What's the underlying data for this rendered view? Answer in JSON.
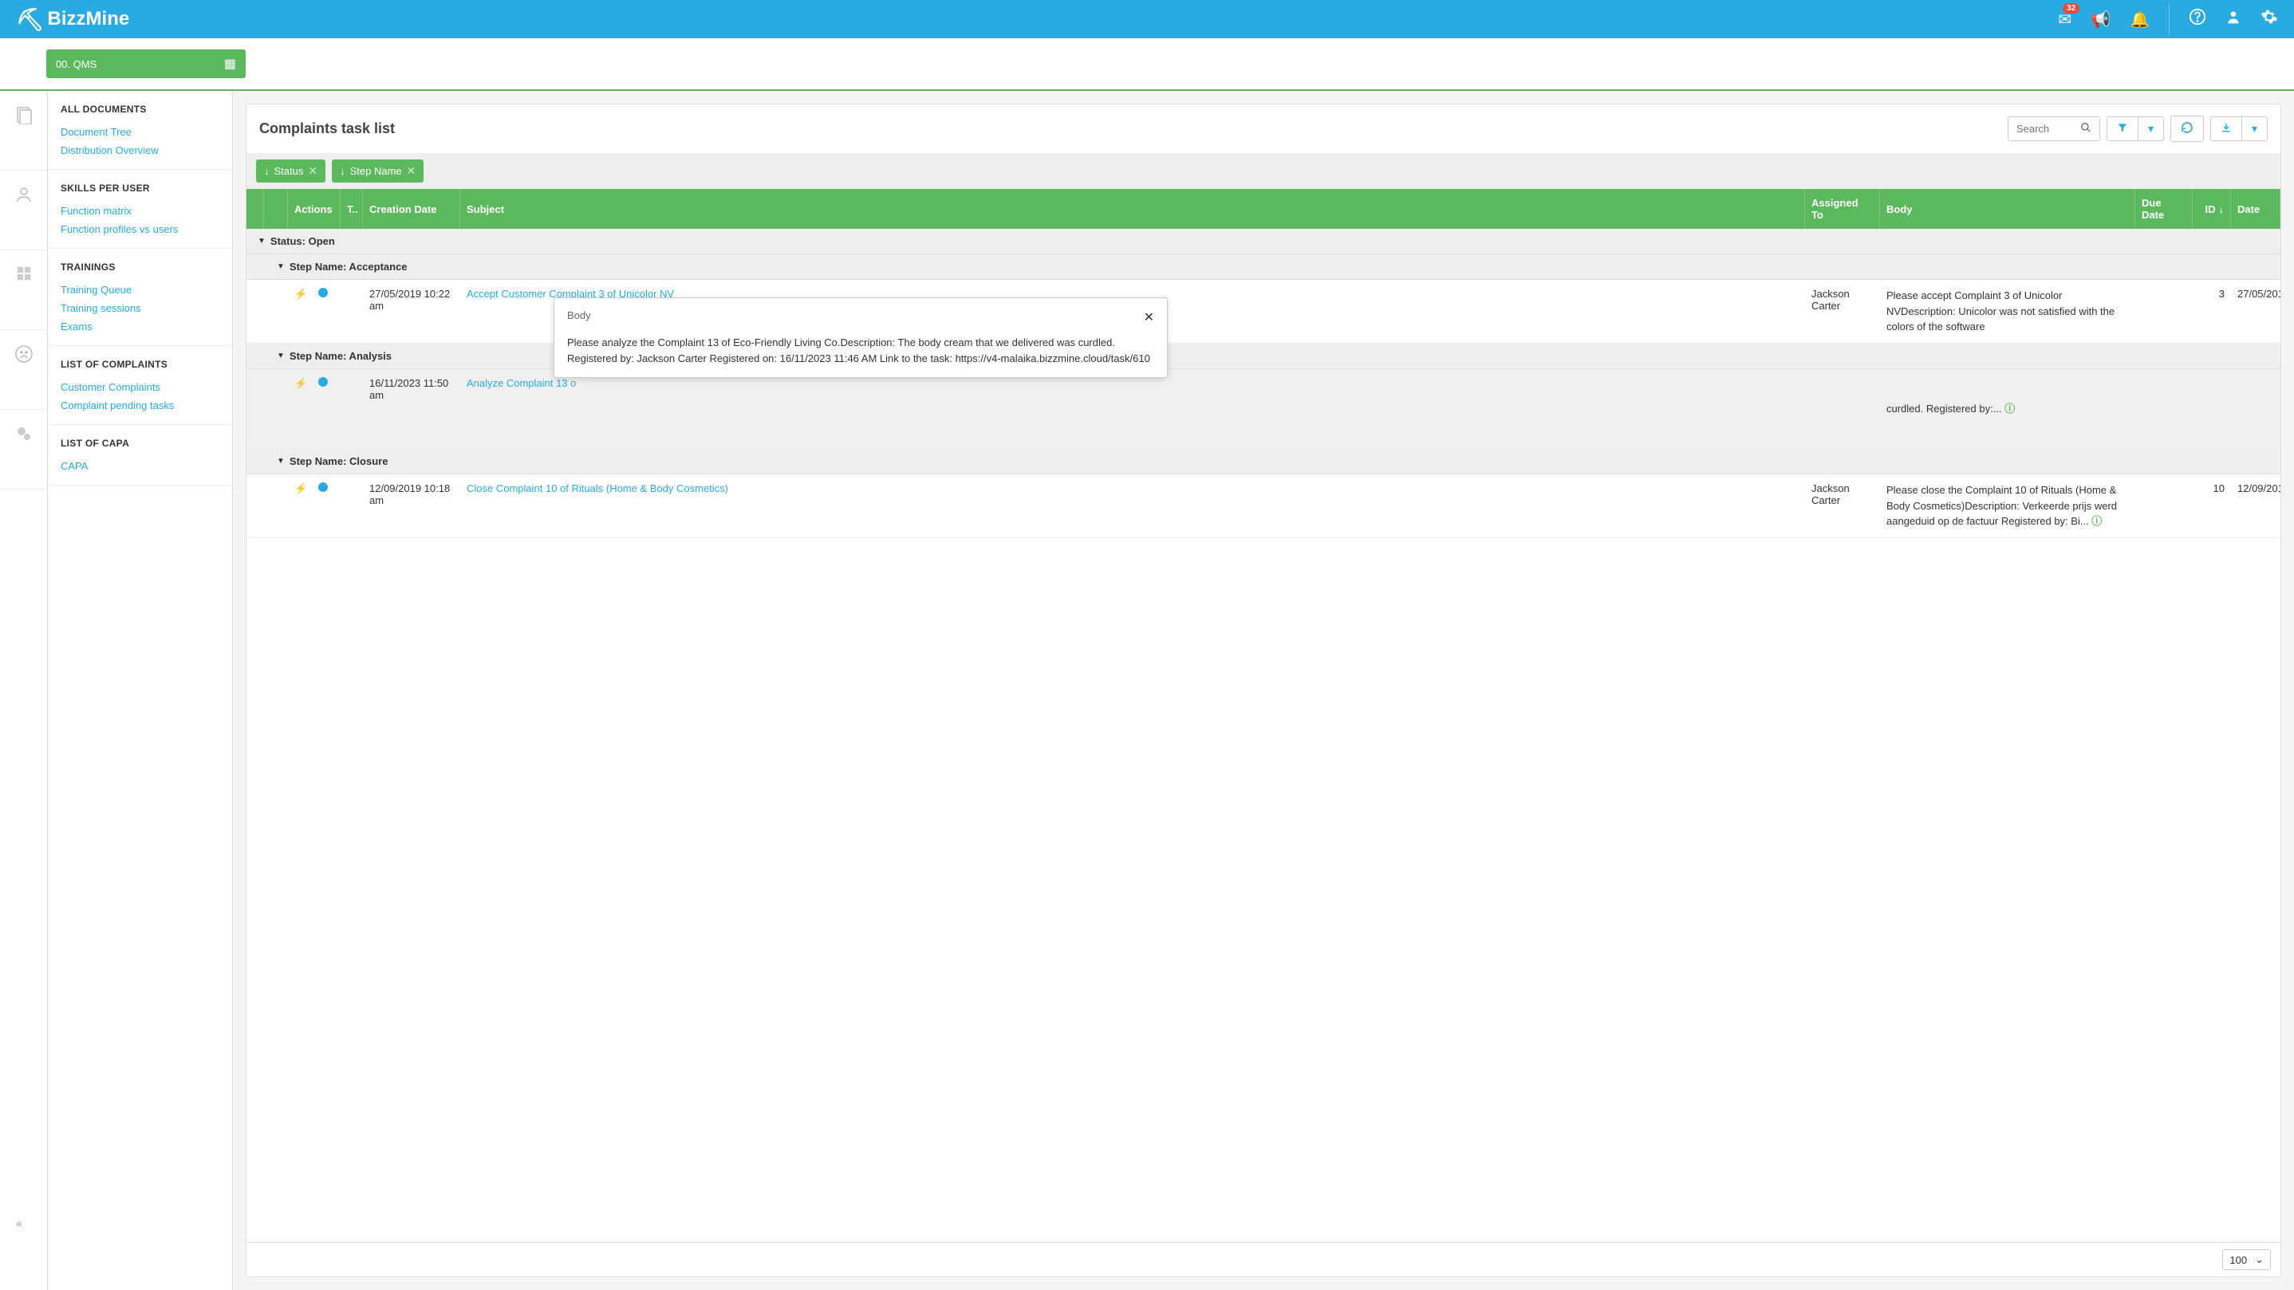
{
  "header": {
    "brand": "BizzMine",
    "mail_badge": "32"
  },
  "workspace": {
    "label": "00. QMS"
  },
  "sidebar": {
    "sections": [
      {
        "heading": "ALL DOCUMENTS",
        "links": [
          "Document Tree",
          "Distribution Overview"
        ]
      },
      {
        "heading": "SKILLS PER USER",
        "links": [
          "Function matrix",
          "Function profiles vs users"
        ]
      },
      {
        "heading": "TRAININGS",
        "links": [
          "Training Queue",
          "Training sessions",
          "Exams"
        ]
      },
      {
        "heading": "LIST OF COMPLAINTS",
        "links": [
          "Customer Complaints",
          "Complaint pending tasks"
        ]
      },
      {
        "heading": "LIST OF CAPA",
        "links": [
          "CAPA"
        ]
      }
    ]
  },
  "main": {
    "title": "Complaints task list",
    "search_placeholder": "Search",
    "chips": [
      "Status",
      "Step Name"
    ],
    "columns": {
      "actions": "Actions",
      "type": "T..",
      "creation": "Creation Date",
      "subject": "Subject",
      "assigned": "Assigned To",
      "body": "Body",
      "due": "Due Date",
      "id": "ID",
      "date": "Date"
    },
    "group_status": "Status: Open",
    "groups": [
      {
        "name": "Step Name: Acceptance",
        "rows": [
          {
            "date": "27/05/2019 10:22 am",
            "subject": "Accept Customer Complaint 3 of Unicolor NV",
            "assigned": "Jackson Carter",
            "body": "Please accept Complaint 3 of Unicolor NVDescription: Unicolor was not satisfied with the colors of the software",
            "id": "3",
            "enddate": "27/05/201"
          }
        ]
      },
      {
        "name": "Step Name: Analysis",
        "rows": [
          {
            "highlighted": true,
            "date": "16/11/2023 11:50 am",
            "subject": "Analyze Complaint 13 o",
            "assigned": "",
            "body": "curdled.  Registered by:...",
            "id": "",
            "enddate": ""
          }
        ]
      },
      {
        "name": "Step Name: Closure",
        "rows": [
          {
            "date": "12/09/2019 10:18 am",
            "subject": "Close Complaint 10 of Rituals (Home & Body Cosmetics)",
            "assigned": "Jackson Carter",
            "body": "Please close the Complaint 10 of Rituals (Home & Body Cosmetics)Description: Verkeerde prijs werd aangeduid op de factuur Registered by:  Bi...",
            "id": "10",
            "enddate": "12/09/201"
          }
        ]
      }
    ],
    "page_size": "100"
  },
  "tooltip": {
    "title": "Body",
    "content": "Please analyze the Complaint  13  of Eco-Friendly Living Co.Description: The body cream that we delivered was curdled.  Registered by:  Jackson Carter Registered on:  16/11/2023 11:46 AM Link to the task: https://v4-malaika.bizzmine.cloud/task/610"
  }
}
